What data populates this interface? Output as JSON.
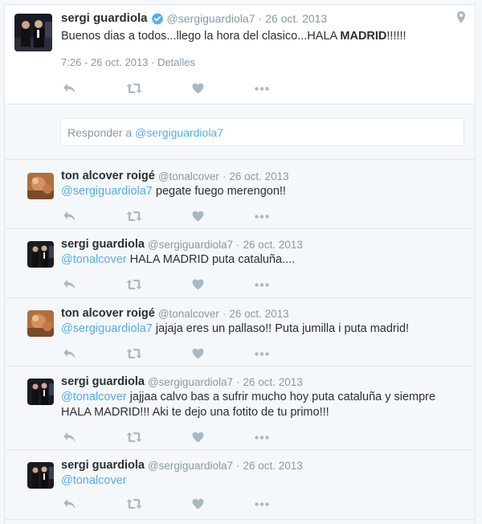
{
  "main_tweet": {
    "name": "sergi guardiola",
    "handle": "@sergiguardiola7",
    "date": "26 oct. 2013",
    "text_prefix": "Buenos dias a todos...llego la hora del clasico...HALA ",
    "text_bold": "MADRID",
    "text_suffix": "!!!!!!",
    "timestamp": "7:26 - 26 oct. 2013",
    "details_label": "Detalles"
  },
  "reply_box": {
    "prefix": "Responder a ",
    "mention": "@sergiguardiola7"
  },
  "replies": [
    {
      "name": "ton alcover roigé",
      "handle": "@tonalcover",
      "date": "26 oct. 2013",
      "mention": "@sergiguardiola7",
      "text": " pegate fuego merengon!!"
    },
    {
      "name": "sergi guardiola",
      "handle": "@sergiguardiola7",
      "date": "26 oct. 2013",
      "mention": "@tonalcover",
      "text": " HALA MADRID puta cataluña...."
    },
    {
      "name": "ton alcover roigé",
      "handle": "@tonalcover",
      "date": "26 oct. 2013",
      "mention": "@sergiguardiola7",
      "text": " jajaja eres un pallaso!! Puta jumilla i puta madrid!"
    },
    {
      "name": "sergi guardiola",
      "handle": "@sergiguardiola7",
      "date": "26 oct. 2013",
      "mention": "@tonalcover",
      "text": " jajjaa calvo bas a sufrir mucho hoy puta cataluña y siempre HALA MADRID!!! Aki te dejo una fotito de tu primo!!!"
    },
    {
      "name": "sergi guardiola",
      "handle": "@sergiguardiola7",
      "date": "26 oct. 2013",
      "mention": "@tonalcover",
      "text": ""
    }
  ],
  "separator": "·",
  "icons": {
    "reply": "reply-icon",
    "retweet": "retweet-icon",
    "like": "heart-icon",
    "more": "more-icon",
    "location": "location-pin-icon",
    "verified": "verified-badge-icon"
  },
  "colors": {
    "link": "#55acee",
    "muted": "#8899a6",
    "icon": "#aab8c2",
    "verified": "#55acee"
  }
}
